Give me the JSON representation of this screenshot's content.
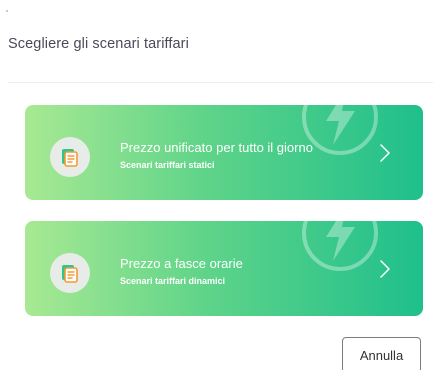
{
  "dialog": {
    "title": "Scegliere gli scenari tariffari"
  },
  "options": [
    {
      "title": "Prezzo unificato per tutto il giorno",
      "subtitle": "Scenari tariffari statici",
      "icon": "document-icon",
      "watermark_icon": "lightning-bolt-icon",
      "arrow_icon": "chevron-right-icon"
    },
    {
      "title": "Prezzo a fasce orarie",
      "subtitle": "Scenari tariffari dinamici",
      "icon": "document-icon",
      "watermark_icon": "lightning-bolt-icon",
      "arrow_icon": "chevron-right-icon"
    }
  ],
  "footer": {
    "cancel_label": "Annulla"
  },
  "colors": {
    "card_gradient_start": "#a8e993",
    "card_gradient_end": "#1fbf8c",
    "document_icon_front": "#f59a33",
    "document_icon_back": "#2fc58f",
    "badge_background": "#e7ece8",
    "title_text": "#4a4a5a"
  }
}
